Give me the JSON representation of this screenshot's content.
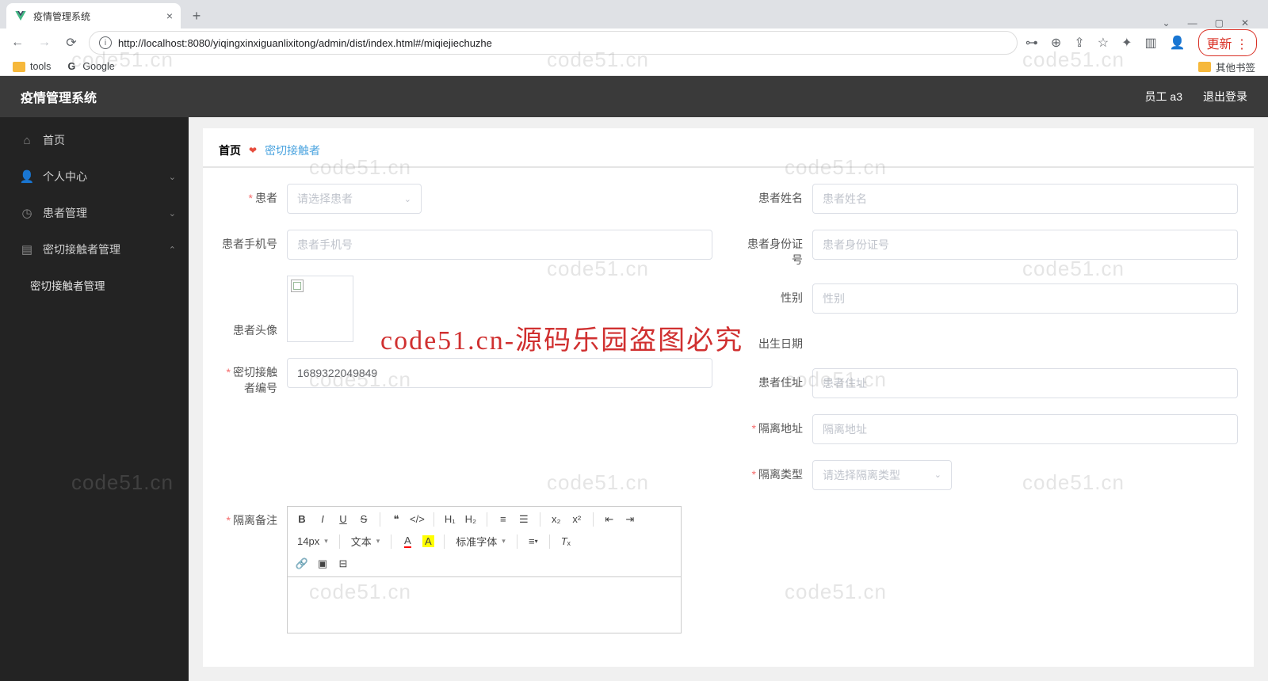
{
  "browser": {
    "tab_title": "疫情管理系统",
    "url_host": "localhost",
    "url_full": "http://localhost:8080/yiqingxinxiguanlixitong/admin/dist/index.html#/miqiejiechuzhe",
    "update_btn": "更新",
    "bookmarks": {
      "tools": "tools",
      "google": "Google",
      "other": "其他书签"
    }
  },
  "header": {
    "title": "疫情管理系统",
    "user": "员工 a3",
    "logout": "退出登录"
  },
  "sidebar": {
    "home": "首页",
    "personal": "个人中心",
    "patient": "患者管理",
    "contact": "密切接触者管理",
    "contact_sub": "密切接触者管理"
  },
  "crumb": {
    "home": "首页",
    "current": "密切接触者"
  },
  "labels": {
    "patient": "患者",
    "patient_name": "患者姓名",
    "patient_phone": "患者手机号",
    "patient_idnum": "患者身份证号",
    "patient_avatar": "患者头像",
    "gender": "性别",
    "birthday": "出生日期",
    "addr": "患者住址",
    "contact_no": "密切接触者编号",
    "iso_addr": "隔离地址",
    "iso_type": "隔离类型",
    "iso_note": "隔离备注"
  },
  "ph": {
    "patient": "请选择患者",
    "patient_name": "患者姓名",
    "patient_phone": "患者手机号",
    "patient_idnum": "患者身份证号",
    "gender": "性别",
    "addr": "患者住址",
    "iso_addr": "隔离地址",
    "iso_type": "请选择隔离类型"
  },
  "values": {
    "contact_no": "1689322049849"
  },
  "editor": {
    "font_size": "14px",
    "font_family": "文本",
    "font_name": "标准字体"
  },
  "wm": {
    "text": "code51.cn",
    "red": "code51.cn-源码乐园盗图必究"
  }
}
